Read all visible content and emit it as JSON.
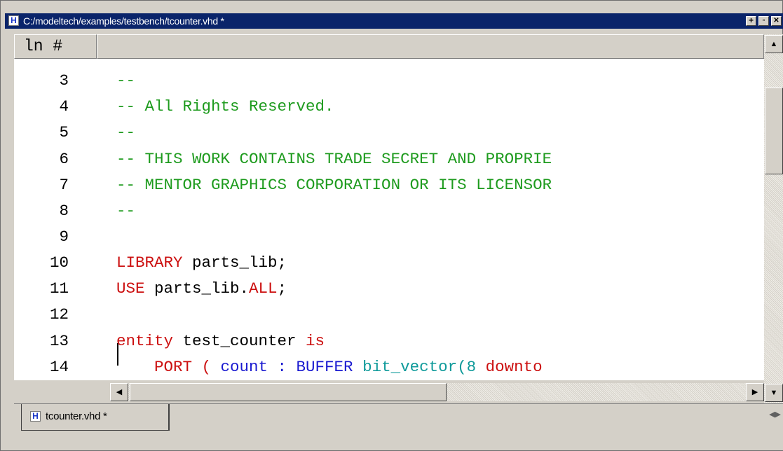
{
  "window": {
    "title": "C:/modeltech/examples/testbench/tcounter.vhd *",
    "buttons": [
      "+",
      "▫",
      "✕"
    ]
  },
  "header": {
    "line_number_label": "ln #"
  },
  "editor": {
    "lines": [
      {
        "num": "3",
        "tokens": [
          {
            "t": "--",
            "c": "comment"
          }
        ]
      },
      {
        "num": "4",
        "tokens": [
          {
            "t": "-- All Rights Reserved.",
            "c": "comment"
          }
        ]
      },
      {
        "num": "5",
        "tokens": [
          {
            "t": "--",
            "c": "comment"
          }
        ]
      },
      {
        "num": "6",
        "tokens": [
          {
            "t": "-- THIS WORK CONTAINS TRADE SECRET AND PROPRIE",
            "c": "comment"
          }
        ]
      },
      {
        "num": "7",
        "tokens": [
          {
            "t": "-- MENTOR GRAPHICS CORPORATION OR ITS LICENSOR",
            "c": "comment"
          }
        ]
      },
      {
        "num": "8",
        "tokens": [
          {
            "t": "--",
            "c": "comment"
          }
        ]
      },
      {
        "num": "9",
        "tokens": []
      },
      {
        "num": "10",
        "tokens": [
          {
            "t": "LIBRARY",
            "c": "kw"
          },
          {
            "t": " parts_lib;",
            "c": "id"
          }
        ]
      },
      {
        "num": "11",
        "tokens": [
          {
            "t": "USE",
            "c": "kw"
          },
          {
            "t": " parts_lib.",
            "c": "id"
          },
          {
            "t": "ALL",
            "c": "kw"
          },
          {
            "t": ";",
            "c": "id"
          }
        ]
      },
      {
        "num": "12",
        "tokens": []
      },
      {
        "num": "13",
        "tokens": [
          {
            "t": "entity",
            "c": "kw"
          },
          {
            "t": " test_counter ",
            "c": "id"
          },
          {
            "t": "is",
            "c": "kw"
          }
        ]
      },
      {
        "num": "14",
        "tokens": [
          {
            "t": "    PORT ( ",
            "c": "kw"
          },
          {
            "t": "count : BUFFER",
            "c": "type"
          },
          {
            "t": " bit_vector(8 ",
            "c": "cyan"
          },
          {
            "t": "downto",
            "c": "kw"
          }
        ]
      }
    ]
  },
  "tabs": [
    {
      "label": "tcounter.vhd *"
    }
  ],
  "colors": {
    "comment": "#1e9b1e",
    "keyword": "#cc1010",
    "type": "#1a1ad0",
    "title_bar": "#0a246a"
  }
}
